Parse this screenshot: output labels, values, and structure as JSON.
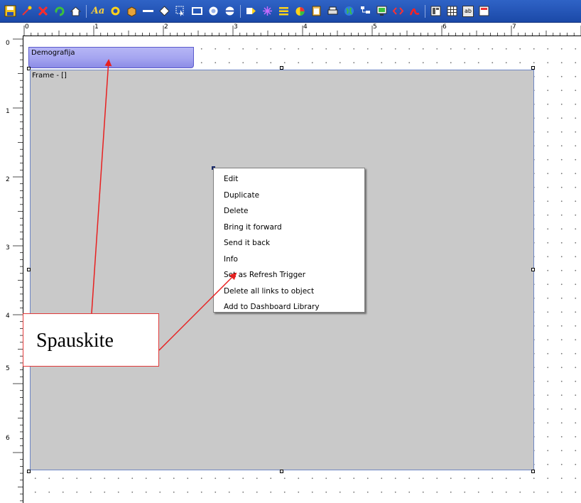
{
  "toolbar": {
    "font_button_label": "Aa",
    "text_box_label": "ab",
    "icons": [
      "save-icon",
      "wand-icon",
      "delete-icon",
      "refresh-icon",
      "home-icon",
      "font-icon",
      "flower-icon",
      "box-icon",
      "line-icon",
      "diamond-icon",
      "cursor-icon",
      "rectangle-icon",
      "circle-icon",
      "ellipse-icon",
      "tag-icon",
      "network-icon",
      "list-icon",
      "pie-chart-icon",
      "paste-icon",
      "print-icon",
      "globe-icon",
      "tree-icon",
      "monitor-icon",
      "code-icon",
      "pdf-icon",
      "layout-icon",
      "table-icon",
      "text-box-icon",
      "grid-icon"
    ],
    "accent_color": "#1f4fb0"
  },
  "ruler": {
    "top_labels": [
      "0",
      "1",
      "2",
      "3",
      "4",
      "5",
      "6",
      "7"
    ],
    "left_labels": [
      "0",
      "1",
      "2",
      "3",
      "4",
      "5",
      "6"
    ]
  },
  "title_widget": {
    "label": "Demografija",
    "color": "#a4a4f0"
  },
  "frame": {
    "label": "Frame - []",
    "color": "#c9c9c9"
  },
  "context_menu": {
    "items": [
      "Edit",
      "Duplicate",
      "Delete",
      "Bring it forward",
      "Send it back",
      "Info",
      "Set as Refresh Trigger",
      "Delete all links to object",
      "Add to Dashboard Library"
    ]
  },
  "annotation": {
    "text": "Spauskite",
    "color": "#e23a3a"
  }
}
